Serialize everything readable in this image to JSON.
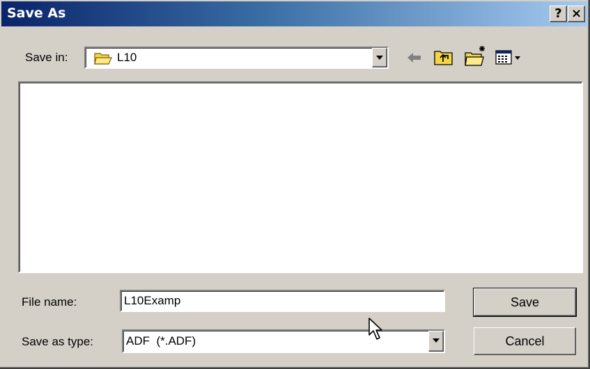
{
  "window": {
    "title": "Save As",
    "help_label": "?",
    "close_label": "×"
  },
  "save_in": {
    "label": "Save in:",
    "folder": "L10",
    "folder_icon": "folder-icon"
  },
  "toolbar": {
    "icons": [
      "back-arrow-icon",
      "up-folder-icon",
      "new-folder-icon",
      "view-menu-icon"
    ]
  },
  "file_list": {
    "items": []
  },
  "file_name": {
    "label": "File name:",
    "value": "L10Examp"
  },
  "save_as_type": {
    "label": "Save as type:",
    "value": "ADF  (*.ADF)"
  },
  "buttons": {
    "save_label": "Save",
    "cancel_label": "Cancel"
  },
  "colors": {
    "title_bar_start": "#0a246a",
    "title_bar_end": "#a6caf0",
    "dialog_face": "#d4d0c8",
    "folder_yellow": "#f5d547"
  }
}
